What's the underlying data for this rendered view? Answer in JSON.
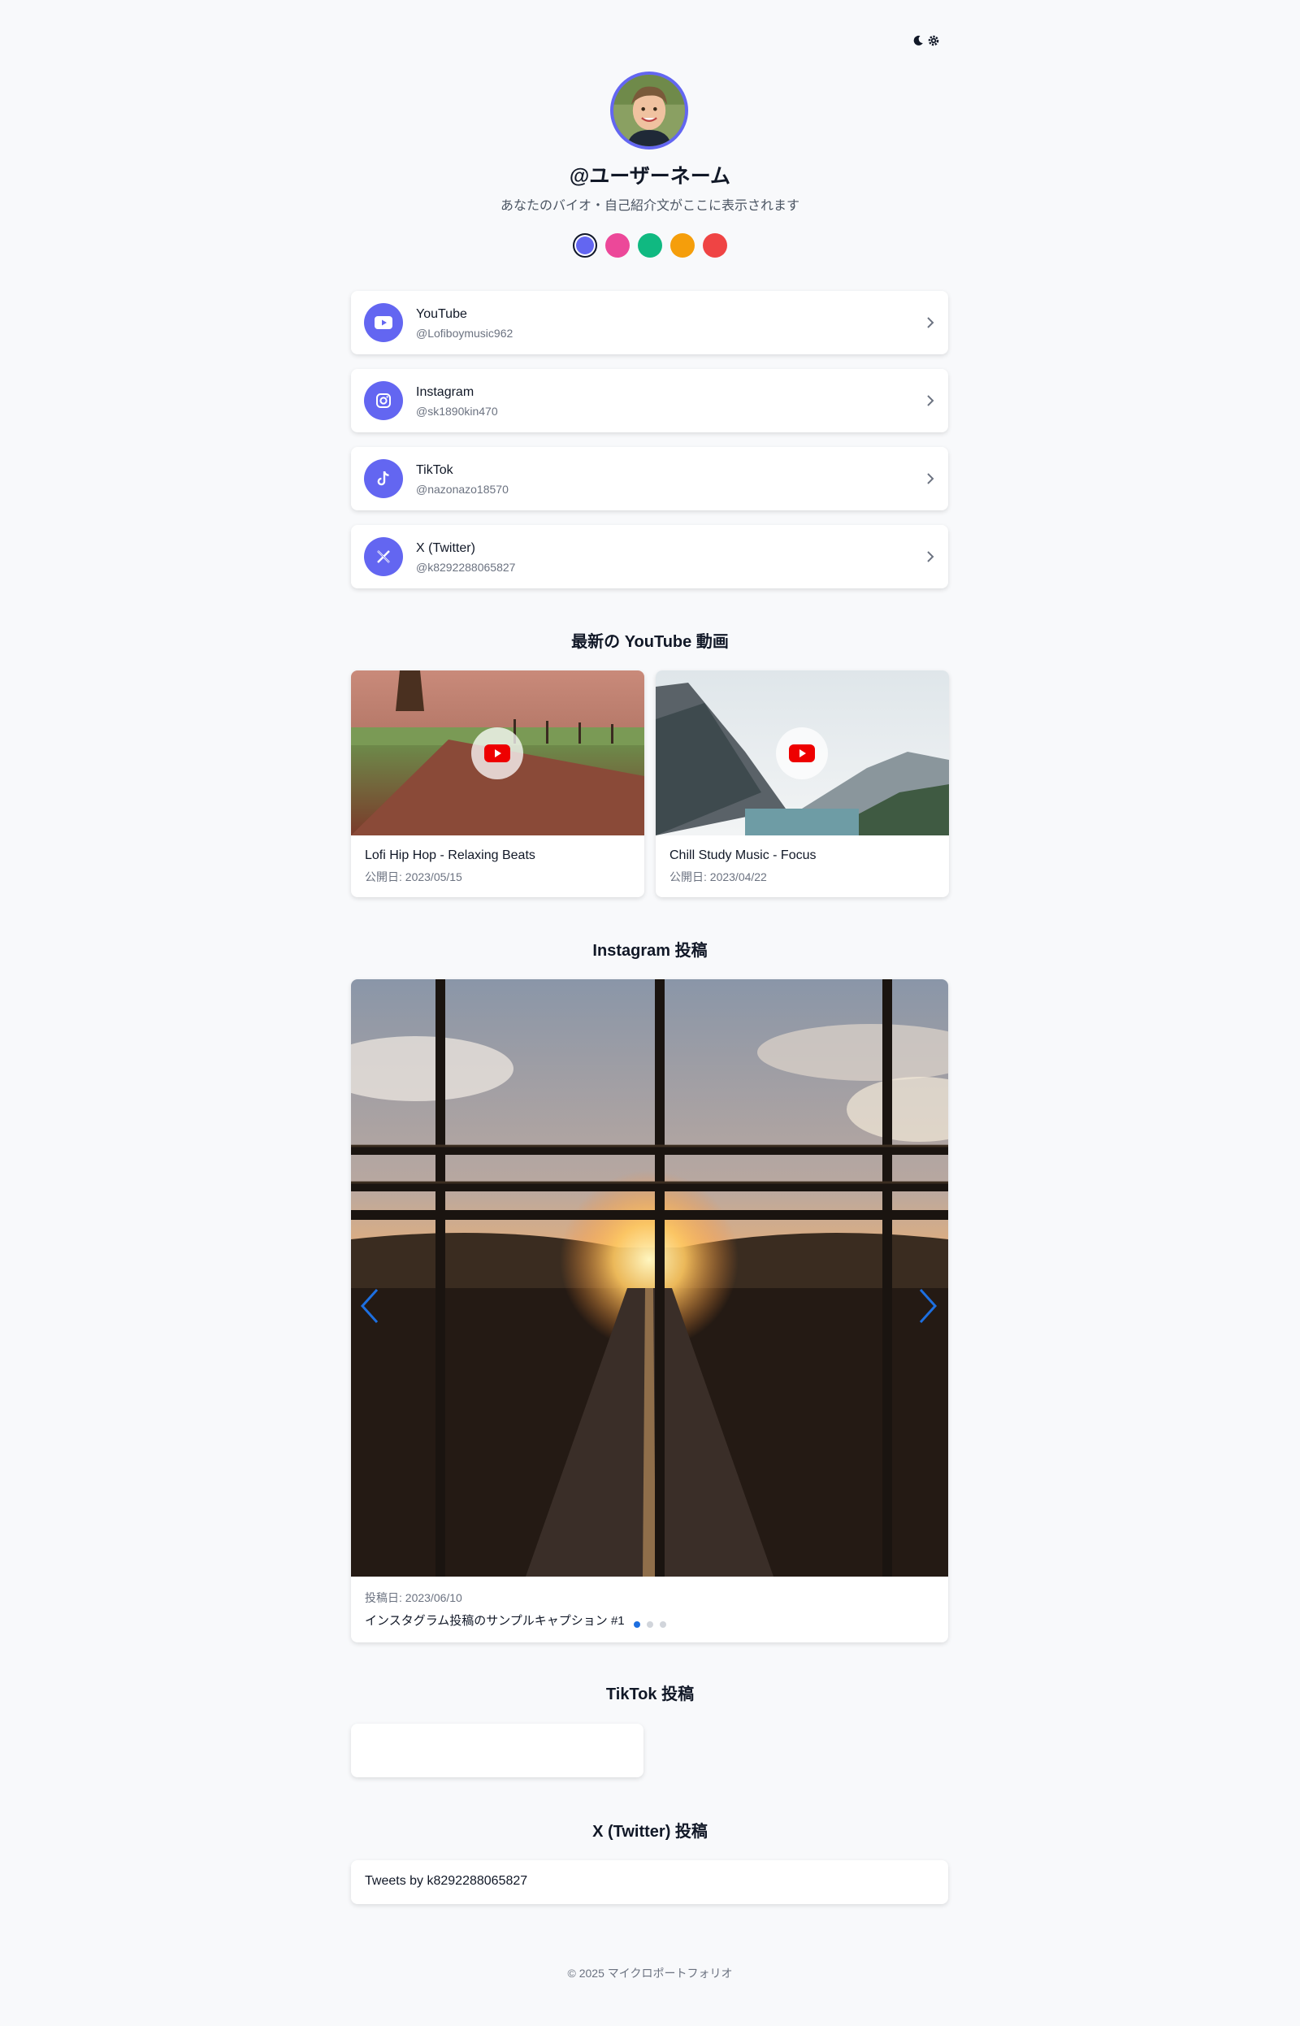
{
  "header": {
    "theme_toggle_icon": "moon-gear-icon"
  },
  "profile": {
    "avatar_icon": "user-avatar",
    "username": "@ユーザーネーム",
    "bio": "あなたのバイオ・自己紹介文がここに表示されます"
  },
  "theme_colors": [
    "#6366f1",
    "#ec4899",
    "#10b981",
    "#f59e0b",
    "#ef4444"
  ],
  "theme_selected": "#6366f1",
  "links": [
    {
      "title": "YouTube",
      "handle": "@Lofiboymusic962",
      "icon": "youtube-icon"
    },
    {
      "title": "Instagram",
      "handle": "@sk1890kin470",
      "icon": "instagram-icon"
    },
    {
      "title": "TikTok",
      "handle": "@nazonazo18570",
      "icon": "tiktok-icon"
    },
    {
      "title": "X (Twitter)",
      "handle": "@k8292288065827",
      "icon": "x-icon"
    }
  ],
  "youtube": {
    "section_title": "最新の YouTube 動画",
    "videos": [
      {
        "title": "Lofi Hip Hop - Relaxing Beats",
        "date": "公開日: 2023/05/15"
      },
      {
        "title": "Chill Study Music - Focus",
        "date": "公開日: 2023/04/22"
      }
    ]
  },
  "instagram": {
    "section_title": "Instagram 投稿",
    "post_date": "投稿日: 2023/06/10",
    "caption": "インスタグラム投稿のサンプルキャプション #1",
    "slide_count": 3,
    "active_slide": 1
  },
  "tiktok": {
    "section_title": "TikTok 投稿"
  },
  "twitter": {
    "section_title": "X (Twitter) 投稿",
    "timeline_text": "Tweets by k8292288065827"
  },
  "footer": {
    "text": "© 2025 マイクロポートフォリオ"
  }
}
